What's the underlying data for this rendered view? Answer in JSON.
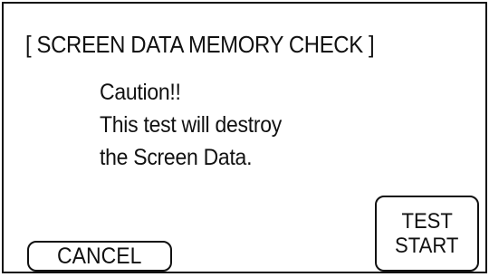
{
  "dialog": {
    "title": "[ SCREEN DATA MEMORY CHECK ]",
    "message_lines": [
      "Caution!!",
      "This test will destroy",
      "the Screen Data."
    ]
  },
  "buttons": {
    "cancel_label": "CANCEL",
    "test_start_line1": "TEST",
    "test_start_line2": "START"
  },
  "colors": {
    "background": "#ffffff",
    "foreground": "#111111"
  }
}
